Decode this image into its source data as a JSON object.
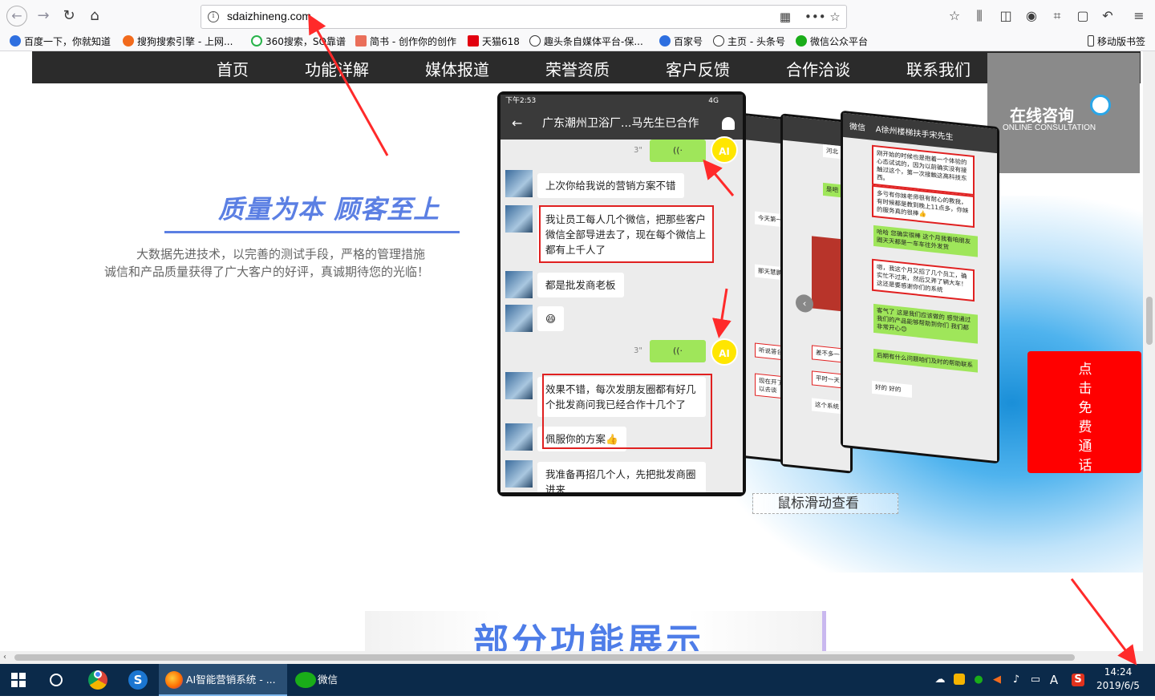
{
  "browser": {
    "url": "sdaizhineng.com",
    "bookmarks": [
      "百度一下，你就知道",
      "搜狗搜索引擎 - 上网...",
      "360搜索，SO靠谱",
      "简书 - 创作你的创作",
      "天猫618",
      "趣头条自媒体平台-保...",
      "百家号",
      "主页 - 头条号",
      "微信公众平台"
    ],
    "mobile_bookmarks": "移动版书签"
  },
  "site": {
    "nav": [
      "首页",
      "功能详解",
      "媒体报道",
      "荣誉资质",
      "客户反馈",
      "合作洽谈",
      "联系我们"
    ],
    "consult_title": "在线咨询",
    "consult_subtitle": "ONLINE CONSULTATION",
    "slogan": "质量为本 顾客至上",
    "desc_line1": "大数据先进技术，以完善的测试手段，严格的管理措施",
    "desc_line2": "诚信和产品质量获得了广大客户的好评，真诚期待您的光临！",
    "hint": "鼠标滑动查看",
    "call_chars": [
      "点",
      "击",
      "免",
      "费",
      "通",
      "话"
    ],
    "section_title": "部分功能展示"
  },
  "chat": {
    "status_time": "下午2:53",
    "status_right": "4G",
    "title": "广东潮州卫浴厂...马先生已合作",
    "voice_seconds": "3\"",
    "ai_label": "AI",
    "messages": [
      "上次你给我说的营销方案不错",
      "我让员工每人几个微信，把那些客户微信全部导进去了，现在每个微信上都有上千人了",
      "都是批发商老板",
      "😄",
      "效果不错，每次发朋友圈都有好几个批发商问我已经合作十几个了",
      "佩服你的方案👍",
      "我准备再招几个人，先把批发商圈进来"
    ]
  },
  "side_phone": {
    "header": "A徐州楼梯扶手宋先生",
    "back": "微信",
    "messages": [
      "刚开始的时候也是抱着一个体验的心态试试的，因为以前确实没有接触过这个，第一次接触这高科技东西。",
      "多亏有你妹老师很有耐心的教我，有时候都是教到晚上11点多，你妹的服务真的很棒👍",
      "哈哈 您确实很棒 这个月我看咱朋友圈天天都是一车车往外发货",
      "嗯，我这个月又招了几个员工，确实忙不过来，然后又弄了辆大车！这还是要感谢你们的系统",
      "客气了 这是我们应该做的 感觉通过我们的产品能够帮助到你们 我们都非常开心😊",
      "后期有什么问题咱们及时的帮助联系",
      "好的 好的"
    ],
    "left_snippets": [
      "今天第一",
      "那天慧鹏",
      "听说答台",
      "现在开了可以去谈"
    ],
    "mid_snippets": [
      "河北",
      "是吧",
      "差不多一",
      "平时一天",
      "这个系统"
    ]
  },
  "taskbar": {
    "tasks": [
      "AI智能营销系统 - ...",
      "微信"
    ],
    "time": "14:24",
    "date": "2019/6/5",
    "ime": "A"
  },
  "colors": {
    "accent_blue": "#5b7fe3",
    "call_red": "#ff0000",
    "nav_bg": "#2b2b2b",
    "annotation_red": "#ff2a2a"
  }
}
